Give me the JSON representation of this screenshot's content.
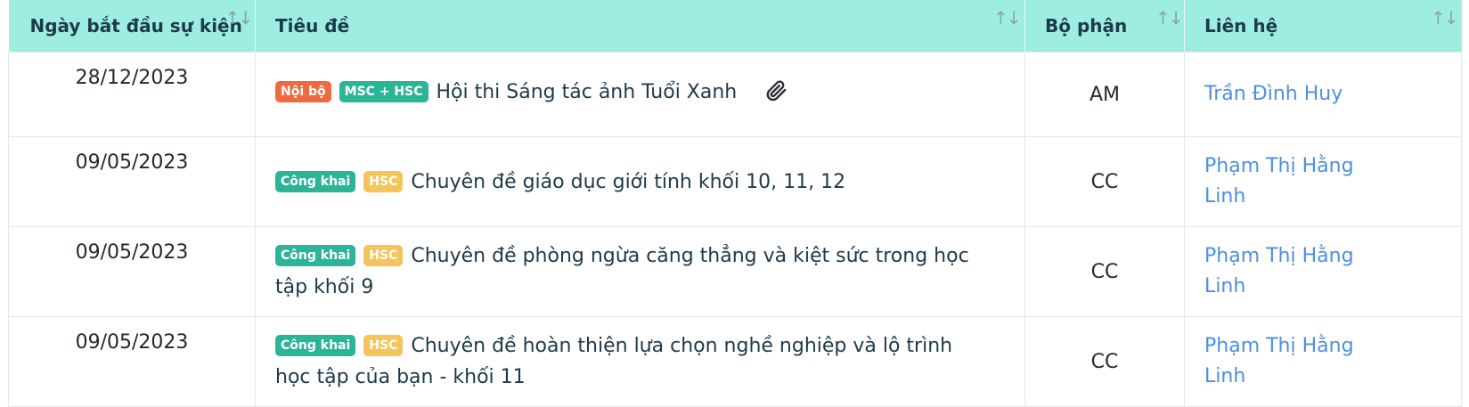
{
  "columns": [
    {
      "label": "Ngày bắt đầu sự kiện"
    },
    {
      "label": "Tiêu đề"
    },
    {
      "label": "Bộ phận"
    },
    {
      "label": "Liên hệ"
    }
  ],
  "sort_icon": "sort-arrows-icon",
  "badge_colors": {
    "Nội bộ": "#f06a3f",
    "MSC + HSC": "#2bb596",
    "Công khai": "#2bb596",
    "HSC": "#f5c45a"
  },
  "rows": [
    {
      "date": "28/12/2023",
      "badges": [
        "Nội bộ",
        "MSC + HSC"
      ],
      "title": "Hội thi Sáng tác ảnh Tuổi Xanh",
      "attachment": "paperclip-icon",
      "dept": "AM",
      "contact_line1": "Trần Đình Huy",
      "contact_line2": ""
    },
    {
      "date": "09/05/2023",
      "badges": [
        "Công khai",
        "HSC"
      ],
      "title": "Chuyên đề giáo dục giới tính khối 10, 11, 12",
      "dept": "CC",
      "contact_line1": "Phạm Thị Hằng",
      "contact_line2": "Linh"
    },
    {
      "date": "09/05/2023",
      "badges": [
        "Công khai",
        "HSC"
      ],
      "title": "Chuyên đề phòng ngừa căng thẳng và kiệt sức trong học tập khối 9",
      "dept": "CC",
      "contact_line1": "Phạm Thị Hằng",
      "contact_line2": "Linh"
    },
    {
      "date": "09/05/2023",
      "badges": [
        "Công khai",
        "HSC"
      ],
      "title": "Chuyên đề hoàn thiện lựa chọn nghề nghiệp và lộ trình học tập của bạn - khối 11",
      "dept": "CC",
      "contact_line1": "Phạm Thị Hằng",
      "contact_line2": "Linh"
    }
  ]
}
